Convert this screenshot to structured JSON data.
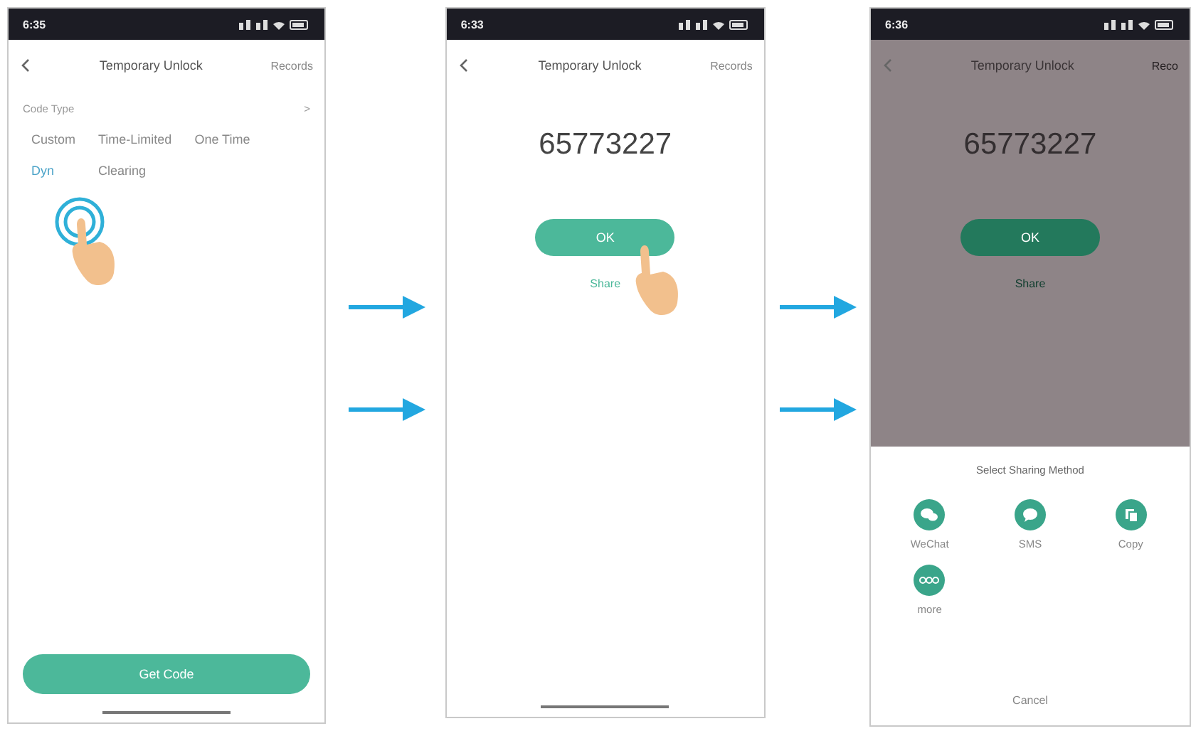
{
  "screens": [
    {
      "kind": "code_type",
      "status_time": "6:35",
      "title": "Temporary Unlock",
      "action": "Records",
      "section_label": "Code Type",
      "chevron": ">",
      "chips": [
        {
          "label": "Custom",
          "selected": false
        },
        {
          "label": "Time-Limited",
          "selected": false
        },
        {
          "label": "One Time",
          "selected": false
        },
        {
          "label": "Dyn",
          "selected": true
        },
        {
          "label": "Clearing",
          "selected": false
        }
      ],
      "button": "Get Code"
    },
    {
      "kind": "code",
      "status_time": "6:33",
      "title": "Temporary Unlock",
      "action": "Records",
      "code": "65773227",
      "button": "OK",
      "link": "Share"
    },
    {
      "kind": "share",
      "status_time": "6:36",
      "title": "Temporary Unlock",
      "action": "Reco",
      "code": "65773227",
      "button": "OK",
      "link": "Share",
      "sheet": {
        "title": "Select Sharing Method",
        "options": [
          {
            "label": "WeChat"
          },
          {
            "label": "SMS"
          },
          {
            "label": "Copy"
          },
          {
            "label": "more"
          }
        ],
        "cancel": "Cancel"
      }
    }
  ]
}
